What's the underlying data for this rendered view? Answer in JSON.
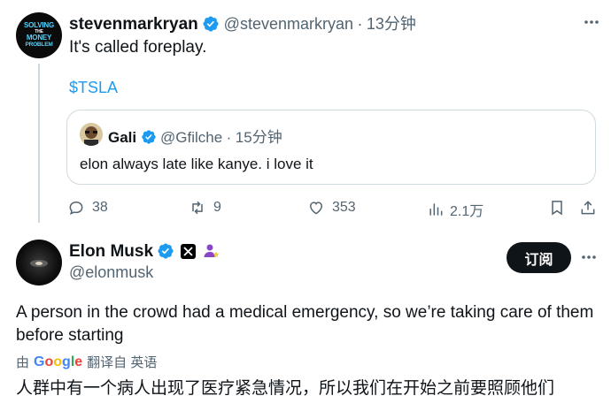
{
  "tweet1": {
    "username": "stevenmarkryan",
    "handle": "@stevenmarkryan",
    "sep": "·",
    "time": "13分钟",
    "text": "It's called foreplay.",
    "cashtag": "$TSLA",
    "avatar_text": [
      "SOLVING",
      "THE",
      "MONEY",
      "PROBLEM"
    ],
    "quote": {
      "name": "Gali",
      "handle": "@Gfilche",
      "sep": "·",
      "time": "15分钟",
      "text": "elon always late like kanye. i love it"
    },
    "actions": {
      "replies": "38",
      "retweets": "9",
      "likes": "353",
      "views": "2.1万"
    }
  },
  "tweet2": {
    "name": "Elon Musk",
    "handle": "@elonmusk",
    "follow_label": "订阅",
    "more": "•••",
    "text": "A person in the crowd had a medical emergency, so we’re taking care of them before starting",
    "translate": {
      "by": "由",
      "google": [
        "G",
        "o",
        "o",
        "g",
        "l",
        "e"
      ],
      "label": "翻译自 英语"
    },
    "translation": "人群中有一个病人出现了医疗紧急情况，所以我们在开始之前要照顾他们"
  },
  "colors": {
    "accent": "#1d9bf0",
    "secondary_text": "#536471",
    "border": "#cfd9de",
    "verified_badge": "#1d9bf0",
    "affiliate_badge": "#8a46c6"
  },
  "icons": [
    "verified-icon",
    "more-icon",
    "reply-icon",
    "retweet-icon",
    "like-icon",
    "views-icon",
    "bookmark-icon",
    "share-icon",
    "x-logo-icon",
    "affiliate-icon",
    "google-logo-icon"
  ]
}
